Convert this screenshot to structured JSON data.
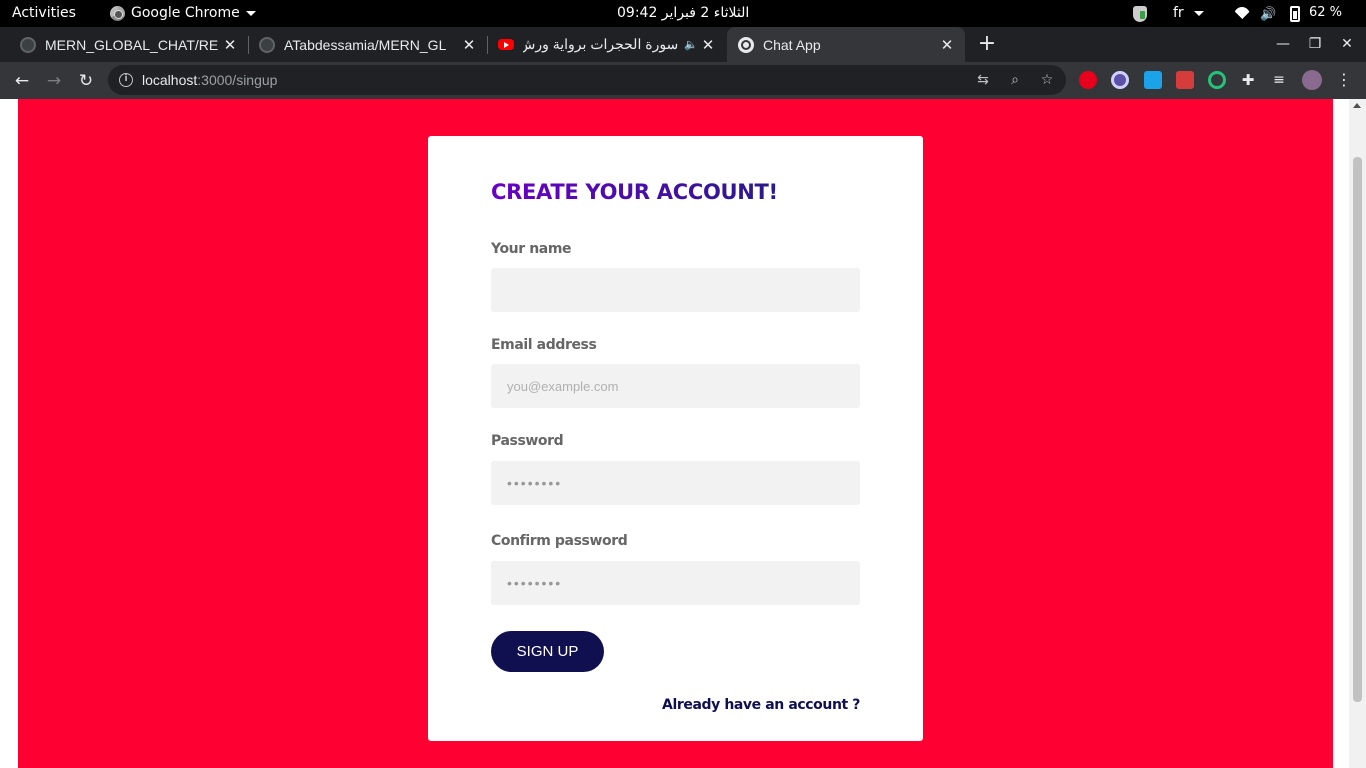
{
  "system_bar": {
    "activities": "Activities",
    "app_name": "Google Chrome",
    "clock": "الثلاثاء 2 فبراير 09:42",
    "language": "fr",
    "battery": "62 %"
  },
  "tabs": [
    {
      "title": "MERN_GLOBAL_CHAT/RE",
      "icon": "github-icon",
      "close": "✕"
    },
    {
      "title": "ATabdessamia/MERN_GL",
      "icon": "github-icon",
      "close": "✕"
    },
    {
      "title": "سورة الحجرات برواية ورش",
      "icon": "youtube-icon",
      "close": "✕"
    },
    {
      "title": "Chat App",
      "icon": "globe-icon",
      "close": "✕",
      "active": true
    }
  ],
  "toolbar": {
    "url_host": "localhost",
    "url_path": ":3000/singup"
  },
  "form": {
    "heading": "CREATE YOUR ACCOUNT!",
    "name_label": "Your name",
    "name_value": "",
    "email_label": "Email address",
    "email_placeholder": "you@example.com",
    "password_label": "Password",
    "password_placeholder": "••••••••",
    "confirm_label": "Confirm password",
    "confirm_placeholder": "••••••••",
    "submit_label": "SIGN UP",
    "login_link": "Already have an account ?"
  },
  "colors": {
    "page_background": "#ff0033",
    "button": "#101050",
    "heading_gradient_start": "#6a00c8",
    "heading_gradient_end": "#2a1a8a"
  }
}
